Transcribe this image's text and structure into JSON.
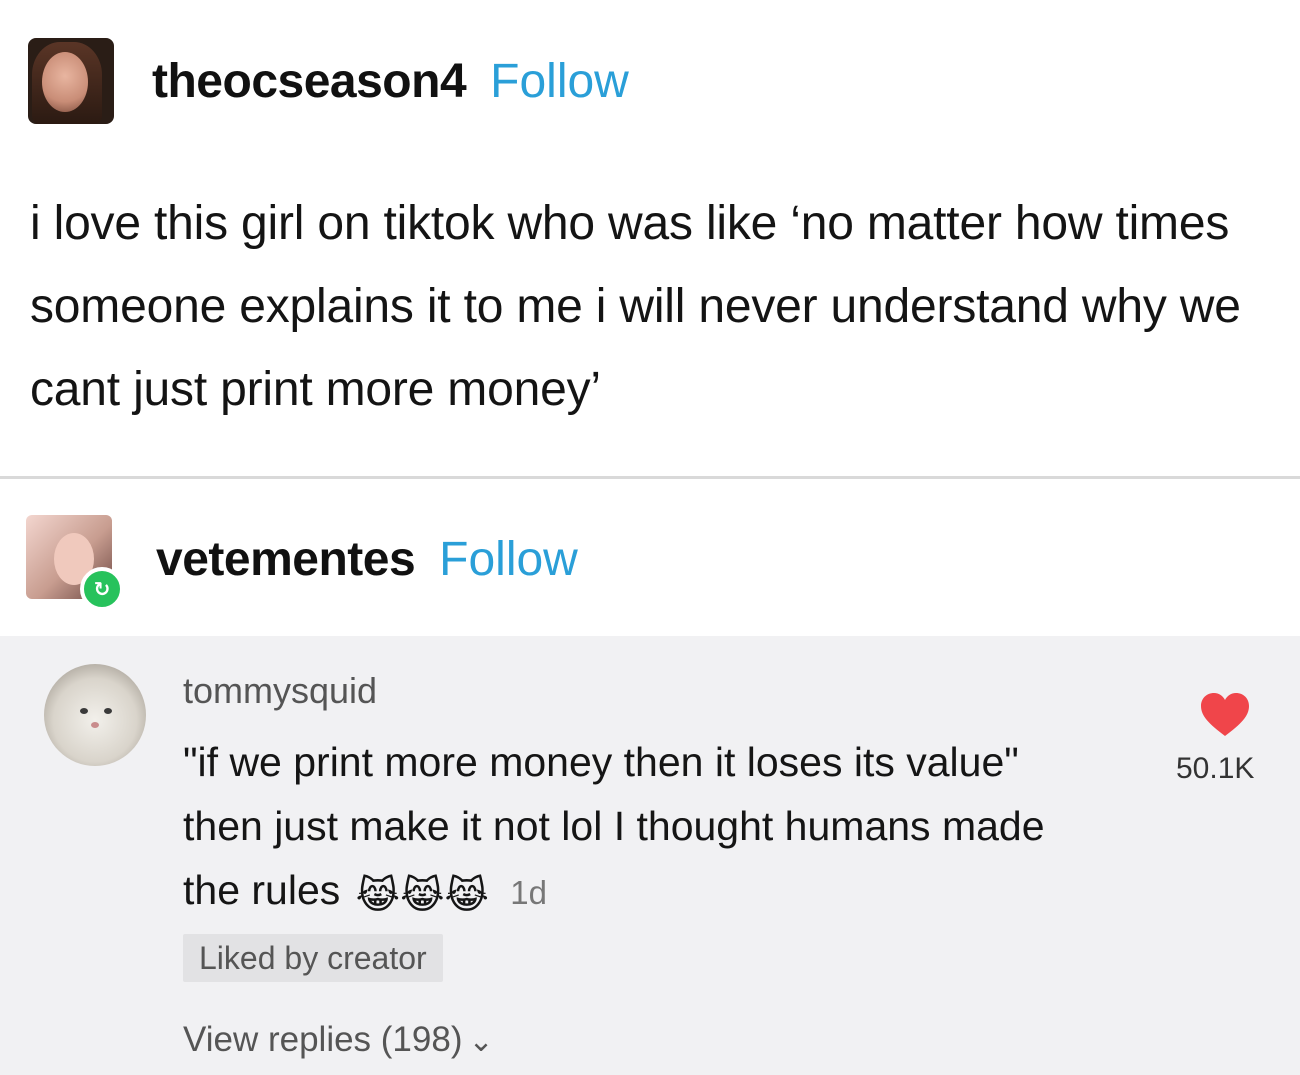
{
  "post": {
    "username": "theocseason4",
    "follow_label": "Follow",
    "text": "i love this girl on tiktok who was like ‘no matter how times someone explains it to me i will never understand why we cant just print more money’"
  },
  "reblog": {
    "username": "vetementes",
    "follow_label": "Follow",
    "reblog_icon": "↻"
  },
  "comment": {
    "author": "tommysquid",
    "text": "\"if we print more money then it loses its value\" then just make it not lol I thought humans made the rules",
    "emoji": "😹😹😹",
    "time": "1d",
    "liked_badge": "Liked by creator",
    "view_replies": "View replies (198)",
    "chevron": "⌄",
    "like_count": "50.1K",
    "heart_color": "#f0454a"
  },
  "colors": {
    "follow_blue": "#2a9fd8",
    "comment_bg": "#f1f1f3",
    "reblog_green": "#27c25c"
  }
}
